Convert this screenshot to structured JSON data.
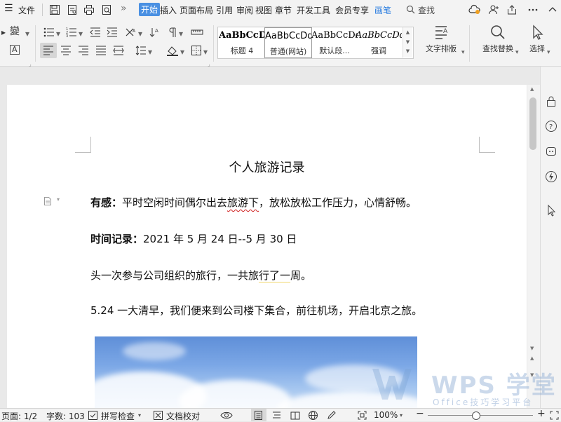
{
  "menubar": {
    "hamburger": "☰",
    "file": "文件",
    "tabs": [
      "开始",
      "插入",
      "页面布局",
      "引用",
      "审阅",
      "视图",
      "章节",
      "开发工具",
      "会员专享",
      "画笔"
    ],
    "search_label": "查找"
  },
  "ribbon": {
    "styles": [
      {
        "preview": "AaBbCcDd",
        "name": "标题 4"
      },
      {
        "preview": "AaBbCcDd",
        "name": "普通(网站)"
      },
      {
        "preview": "AaBbCcDd",
        "name": "默认段..."
      },
      {
        "preview": "AaBbCcDd",
        "name": "强调"
      }
    ],
    "text_layout": "文字排版",
    "find_replace": "查找替换",
    "select": "选择"
  },
  "document": {
    "title": "个人旅游记录",
    "p1_label": "有感：",
    "p1_a": "平时空闲时间偶尔出去",
    "p1_b": "旅游下",
    "p1_c": "，放松放松工作压力，心情舒畅。",
    "p2_label": "时间记录：",
    "p2_text": "2021 年 5 月 24 日--5 月 30 日",
    "p3_a": "头一次参与公司组织的旅行，一共旅",
    "p3_b": "行了一",
    "p3_c": "周。",
    "p4": "5.24 一大清早，我们便来到公司楼下集合，前往机场，开启北京之旅。"
  },
  "statusbar": {
    "page": "页面: 1/2",
    "words": "字数: 103",
    "spell": "拼写检查",
    "proof": "文档校对",
    "zoom": "100%"
  },
  "watermark": {
    "brand": "WPS 学堂",
    "tagline": "Office技巧学习平台"
  },
  "colors": {
    "accent": "#4a90e2",
    "spell_error": "#d02020",
    "grammar_hint": "#f0d870"
  }
}
